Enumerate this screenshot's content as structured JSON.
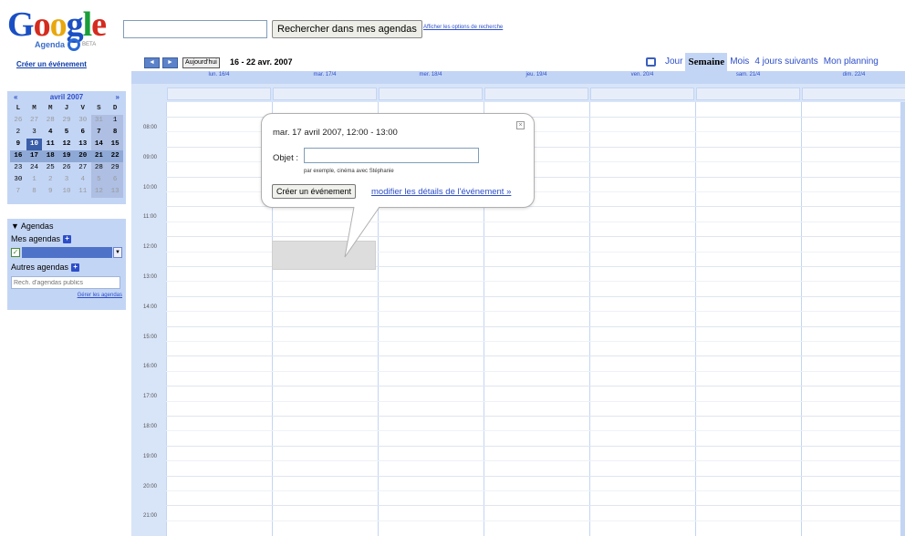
{
  "logo": {
    "word_1": "G",
    "word_2": "o",
    "word_3": "o",
    "word_4": "g",
    "word_5": "l",
    "word_6": "e",
    "sub": "Agenda",
    "beta": "BETA"
  },
  "search": {
    "value": "",
    "button_label": "Rechercher dans mes agendas",
    "options_link": "Afficher les options de recherche"
  },
  "sidebar": {
    "create_link": "Créer un événement",
    "mini_cal": {
      "month": "avril 2007",
      "prev": "«",
      "next": "»",
      "dow": [
        "L",
        "M",
        "M",
        "J",
        "V",
        "S",
        "D"
      ],
      "weeks": [
        [
          "26",
          "27",
          "28",
          "29",
          "30",
          "31",
          "1"
        ],
        [
          "2",
          "3",
          "4",
          "5",
          "6",
          "7",
          "8"
        ],
        [
          "9",
          "10",
          "11",
          "12",
          "13",
          "14",
          "15"
        ],
        [
          "16",
          "17",
          "18",
          "19",
          "20",
          "21",
          "22"
        ],
        [
          "23",
          "24",
          "25",
          "26",
          "27",
          "28",
          "29"
        ],
        [
          "30",
          "1",
          "2",
          "3",
          "4",
          "5",
          "6"
        ],
        [
          "7",
          "8",
          "9",
          "10",
          "11",
          "12",
          "13"
        ]
      ]
    },
    "agendas": {
      "title": "▼ Agendas",
      "mine": "Mes agendas",
      "others": "Autres agendas",
      "public_placeholder": "Rech. d'agendas publics",
      "manage": "Gérer les agendas"
    }
  },
  "toolbar": {
    "prev": "◄",
    "next": "►",
    "today": "Aujourd'hui",
    "range": "16 - 22 avr. 2007",
    "views": [
      {
        "label": "Jour",
        "active": false
      },
      {
        "label": "Semaine",
        "active": true
      },
      {
        "label": "Mois",
        "active": false
      },
      {
        "label": "4 jours suivants",
        "active": false
      },
      {
        "label": "Mon planning",
        "active": false
      }
    ]
  },
  "days": [
    "lun. 16/4",
    "mar. 17/4",
    "mer. 18/4",
    "jeu. 19/4",
    "ven. 20/4",
    "sam. 21/4",
    "dim. 22/4"
  ],
  "hours": [
    "08:00",
    "09:00",
    "10:00",
    "11:00",
    "12:00",
    "13:00",
    "14:00",
    "15:00",
    "16:00",
    "17:00",
    "18:00",
    "19:00",
    "20:00",
    "21:00"
  ],
  "bubble": {
    "time": "mar. 17 avril 2007, 12:00 - 13:00",
    "object_label": "Objet :",
    "object_value": "",
    "hint": "par exemple, cinéma avec Stéphanie",
    "create_button": "Créer un événement",
    "details_link": "modifier les détails de l'événement »",
    "close": "×"
  },
  "colors": {
    "accent": "#c3d5f5",
    "link": "#2d4ec9",
    "selected_day": "#3b5ea8"
  }
}
